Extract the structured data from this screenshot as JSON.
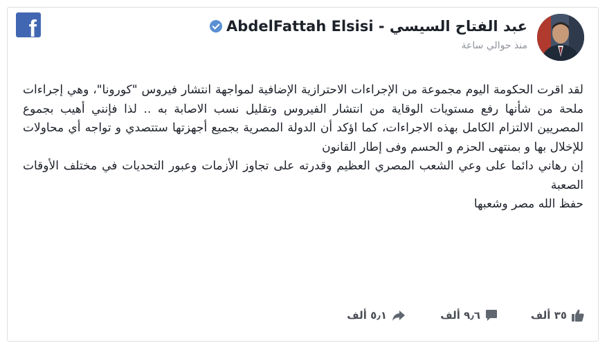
{
  "post": {
    "author": "AbdelFattah Elsisi - عبد الفتاح السيسي",
    "timestamp": "منذ حوالي ساعة",
    "body": [
      "لقد اقرت الحكومة اليوم مجموعة من الإجراءات الاحترازية الإضافية لمواجهة انتشار فيروس \"كورونا\"، وهي إجراءات ملحة من شأنها رفع مستويات الوقاية من انتشار الفيروس وتقليل نسب الاصابة به .. لذا فإنني أهيب بجموع المصريين الالتزام الكامل بهذه الاجراءات، كما اؤكد أن الدولة المصرية بجميع أجهزتها ستتصدي و تواجه أي محاولات للإخلال بها و بمنتهى الحزم و الحسم وفى إطار القانون",
      "إن رهاني دائما على وعي الشعب المصري العظيم وقدرته على تجاوز الأزمات وعبور التحديات في مختلف الأوقات الصعبة",
      "حفظ الله مصر وشعبها"
    ]
  },
  "stats": {
    "likes": "٣٥ ألف",
    "comments": "٩٫٦ ألف",
    "shares": "٥٫١ ألف"
  },
  "icons": {
    "brand": "facebook-logo-icon",
    "verified": "verified-badge-icon",
    "like": "thumbs-up-icon",
    "comment": "comment-bubble-icon",
    "share": "share-arrow-icon"
  },
  "colors": {
    "facebook_blue": "#4267b2",
    "verified_blue": "#5b8fd4",
    "meta_gray": "#90949c",
    "icon_gray": "#606770"
  }
}
